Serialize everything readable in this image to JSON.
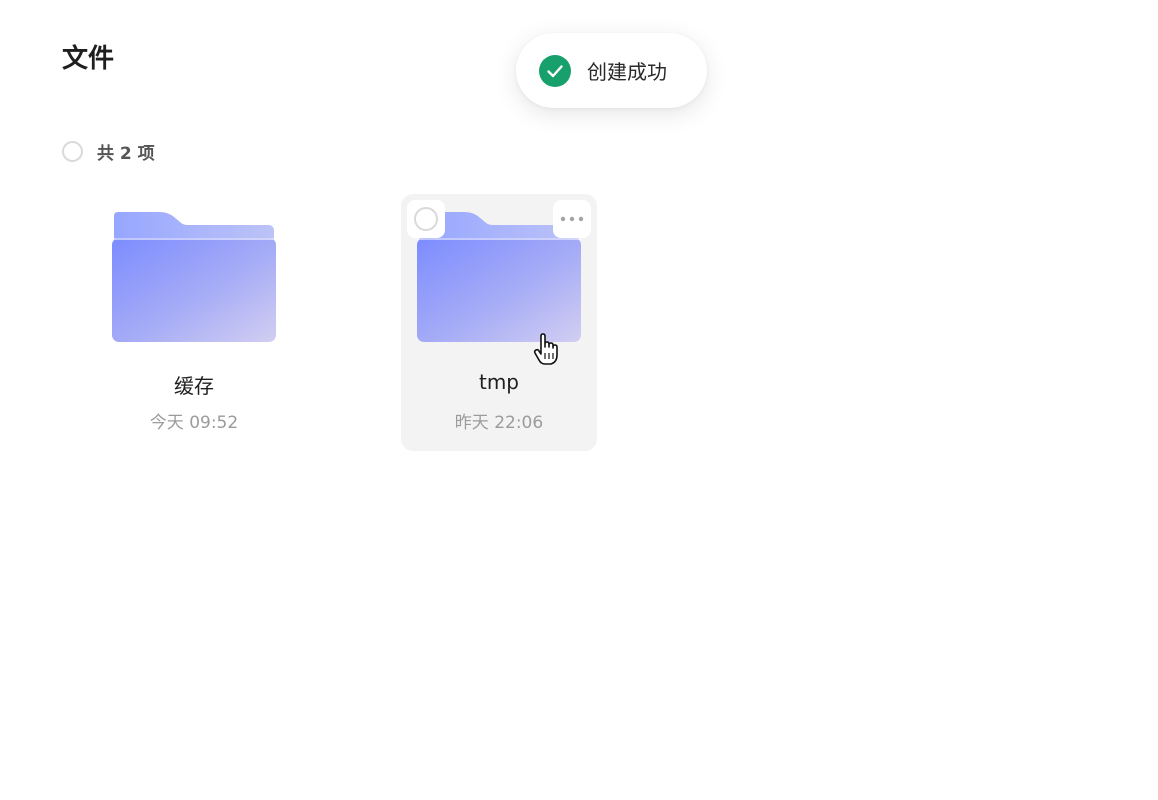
{
  "header": {
    "title": "文件"
  },
  "toast": {
    "message": "创建成功",
    "icon": "check-circle-icon",
    "color": "#17a06c"
  },
  "toolbar": {
    "count_label": "共 2 项"
  },
  "files": [
    {
      "name": "缓存",
      "modified": "今天 09:52",
      "icon": "folder-icon"
    },
    {
      "name": "tmp",
      "modified": "昨天 22:06",
      "icon": "folder-icon"
    }
  ],
  "colors": {
    "folder_front_start": "#7c8cff",
    "folder_front_end": "#cfcbf3",
    "folder_back": "#a3b1ff",
    "hover_background": "#f3f3f3"
  }
}
